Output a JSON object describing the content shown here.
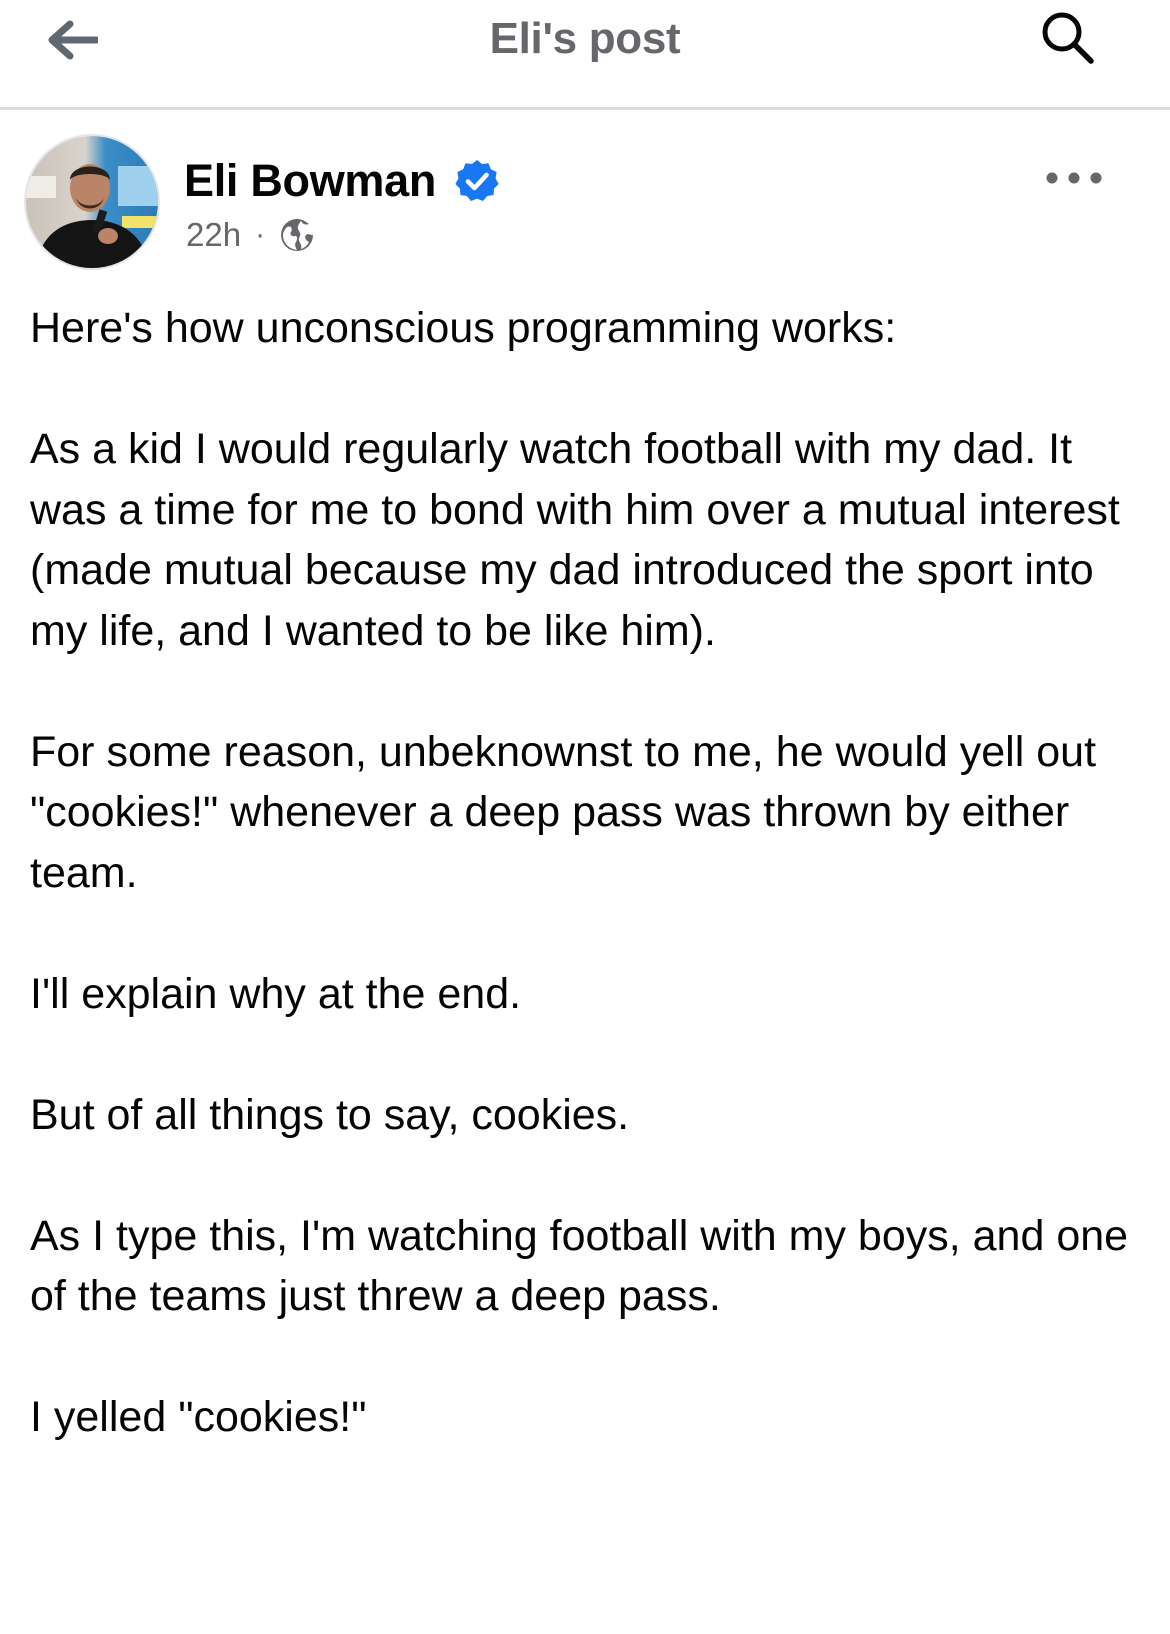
{
  "header": {
    "title": "Eli's post",
    "back_icon": "arrow-left-icon",
    "search_icon": "search-icon"
  },
  "post": {
    "author": "Eli Bowman",
    "verified_icon": "verified-badge-icon",
    "time": "22h",
    "separator": "·",
    "audience_icon": "globe-icon",
    "more_icon": "more-horizontal-icon",
    "paragraphs": [
      "Here's how unconscious programming works:",
      "As a kid I would regularly watch football with my dad. It was a time for me to bond with him over a mutual interest (made mutual because my dad introduced the sport into my life, and I wanted to be like him).",
      "For some reason, unbeknownst to me, he would yell out \"cookies!\" whenever a deep pass was thrown by either team.",
      "I'll explain why at the end.",
      "But of all things to say, cookies.",
      "As I type this, I'm watching football with my boys, and one of the teams just threw a deep pass.",
      "I yelled \"cookies!\""
    ]
  },
  "colors": {
    "verified_blue": "#1877f2",
    "secondary_text": "#65676b",
    "primary_text": "#050505",
    "divider": "#dcdcdc"
  }
}
